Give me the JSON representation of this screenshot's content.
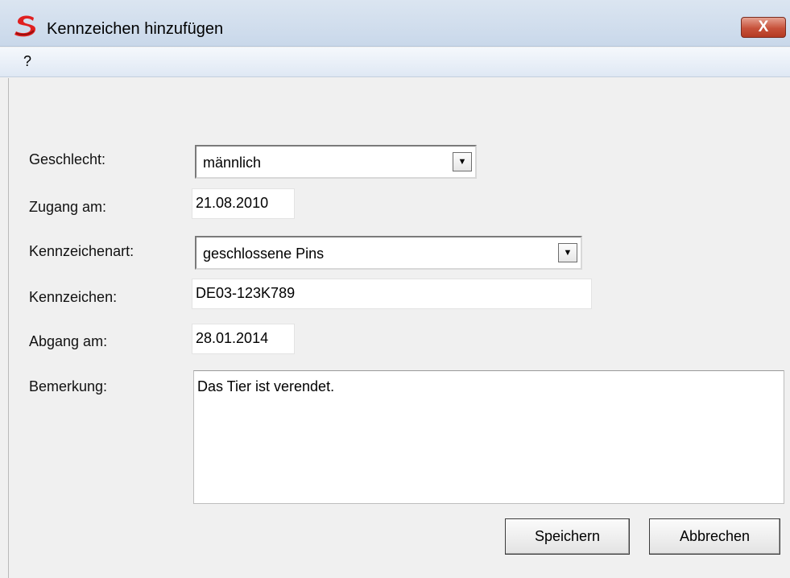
{
  "window": {
    "title": "Kennzeichen hinzufügen",
    "close_glyph": "X"
  },
  "menu": {
    "items": [
      "?"
    ]
  },
  "form": {
    "geschlecht": {
      "label": "Geschlecht:",
      "value": "männlich"
    },
    "zugang": {
      "label": "Zugang am:",
      "value": "21.08.2010"
    },
    "kennzeichenart": {
      "label": "Kennzeichenart:",
      "value": "geschlossene Pins"
    },
    "kennzeichen": {
      "label": "Kennzeichen:",
      "value": "DE03-123K789"
    },
    "abgang": {
      "label": "Abgang am:",
      "value": "28.01.2014"
    },
    "bemerkung": {
      "label": "Bemerkung:",
      "value": "Das Tier ist verendet."
    }
  },
  "buttons": {
    "save": "Speichern",
    "cancel": "Abbrechen"
  },
  "icons": {
    "app": "app-logo-icon",
    "dropdown": "chevron-down-icon"
  },
  "colors": {
    "close_button": "#c7513a",
    "app_icon": "#e02020"
  }
}
